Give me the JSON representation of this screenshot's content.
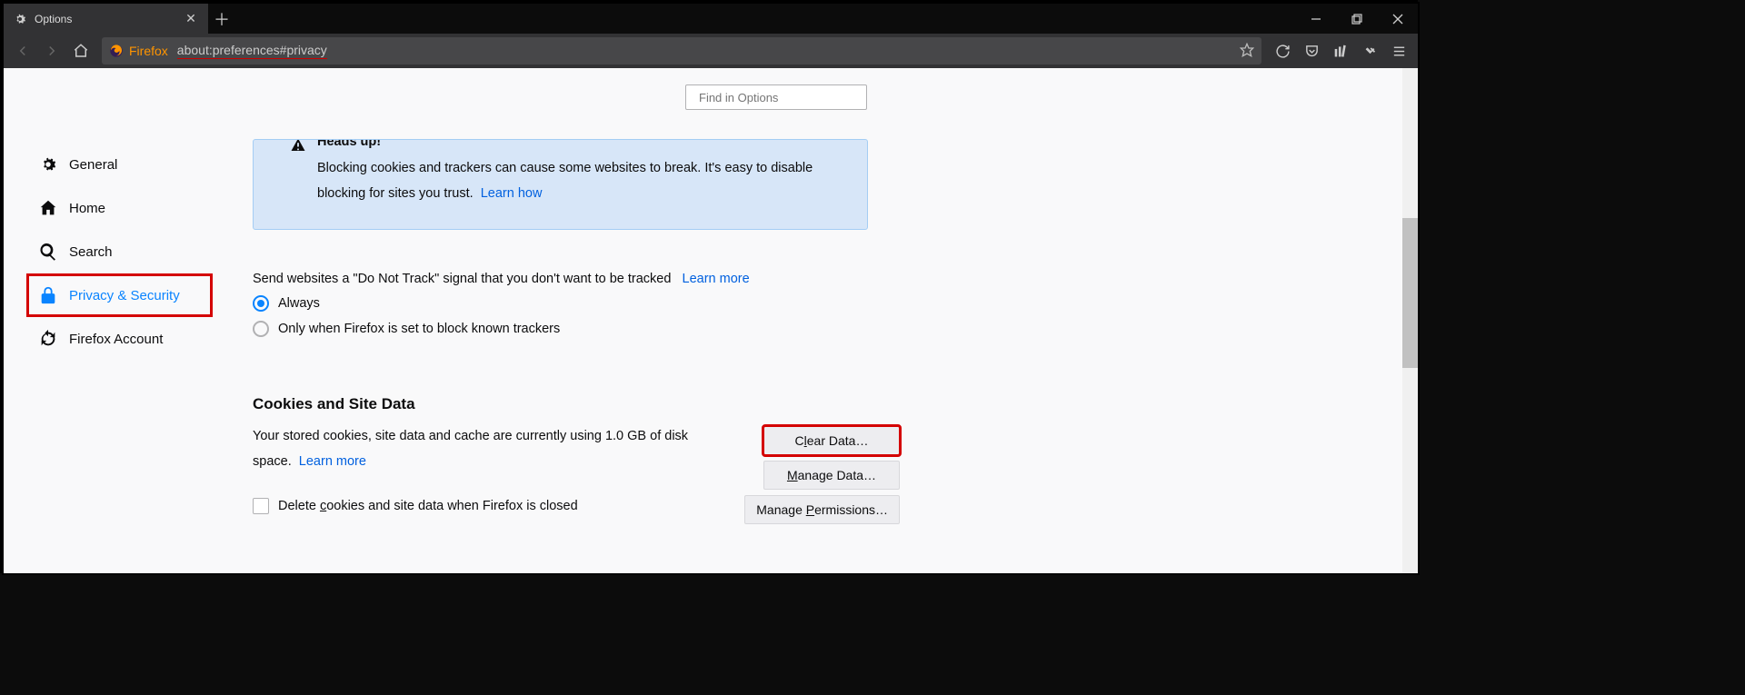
{
  "tab": {
    "title": "Options"
  },
  "url": {
    "brand": "Firefox",
    "path": "about:preferences#privacy"
  },
  "search": {
    "placeholder": "Find in Options"
  },
  "sidebar": {
    "items": [
      {
        "label": "General"
      },
      {
        "label": "Home"
      },
      {
        "label": "Search"
      },
      {
        "label": "Privacy & Security"
      },
      {
        "label": "Firefox Account"
      }
    ]
  },
  "infobox": {
    "heading": "Heads up!",
    "body": "Blocking cookies and trackers can cause some websites to break. It's easy to disable blocking for sites you trust.",
    "link": "Learn how"
  },
  "dnt": {
    "text": "Send websites a \"Do Not Track\" signal that you don't want to be tracked",
    "learn": "Learn more",
    "opt_always": "Always",
    "opt_only": "Only when Firefox is set to block known trackers"
  },
  "cookies": {
    "title": "Cookies and Site Data",
    "desc": "Your stored cookies, site data and cache are currently using 1.0 GB of disk space.",
    "learn": "Learn more",
    "clear_btn": "Clear Data…",
    "manage_btn": "Manage Data…",
    "perm_btn": "Manage Permissions…",
    "delete_check": "Delete cookies and site data when Firefox is closed"
  }
}
